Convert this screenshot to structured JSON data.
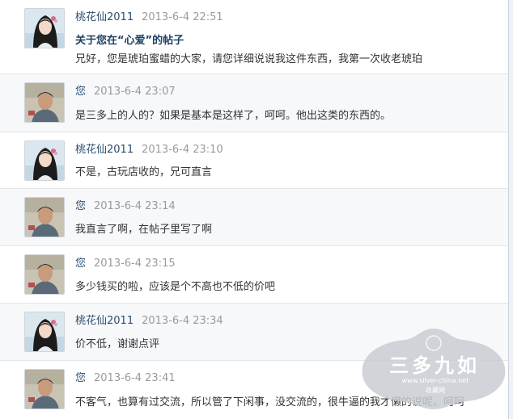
{
  "messages": [
    {
      "author": "桃花仙2011",
      "time": "2013-6-4 22:51",
      "subject": "关于您在“心爱”的帖子",
      "text": "兄好，您是琥珀蜜蜡的大家，请您详细说说我这件东西，我第一次收老琥珀",
      "avatar": "female-avatar"
    },
    {
      "author": "您",
      "time": "2013-6-4 23:07",
      "subject": "",
      "text": "是三多上的人的？如果是基本是这样了，呵呵。他出这类的东西的。",
      "avatar": "male-avatar"
    },
    {
      "author": "桃花仙2011",
      "time": "2013-6-4 23:10",
      "subject": "",
      "text": "不是，古玩店收的，兄可直言",
      "avatar": "female-avatar"
    },
    {
      "author": "您",
      "time": "2013-6-4 23:14",
      "subject": "",
      "text": "我直言了啊，在帖子里写了啊",
      "avatar": "male-avatar"
    },
    {
      "author": "您",
      "time": "2013-6-4 23:15",
      "subject": "",
      "text": "多少钱买的啦，应该是个不高也不低的价吧",
      "avatar": "male-avatar"
    },
    {
      "author": "桃花仙2011",
      "time": "2013-6-4 23:34",
      "subject": "",
      "text": "价不低，谢谢点评",
      "avatar": "female-avatar"
    },
    {
      "author": "您",
      "time": "2013-6-4 23:41",
      "subject": "",
      "text": "不客气，也算有过交流，所以管了下闲事，没交流的，很牛逼的我才懒的说呢。呵呵",
      "avatar": "male-avatar"
    }
  ],
  "watermark": {
    "title": "三多九如",
    "url": "www.silver-china.net",
    "subtitle": "收藏网"
  },
  "colors": {
    "author": "#2b4d6f",
    "time": "#9a9a9a",
    "subject": "#1d3f62",
    "text": "#333333",
    "divider": "#e3e6ea",
    "watermark": "#c9ccd1"
  }
}
